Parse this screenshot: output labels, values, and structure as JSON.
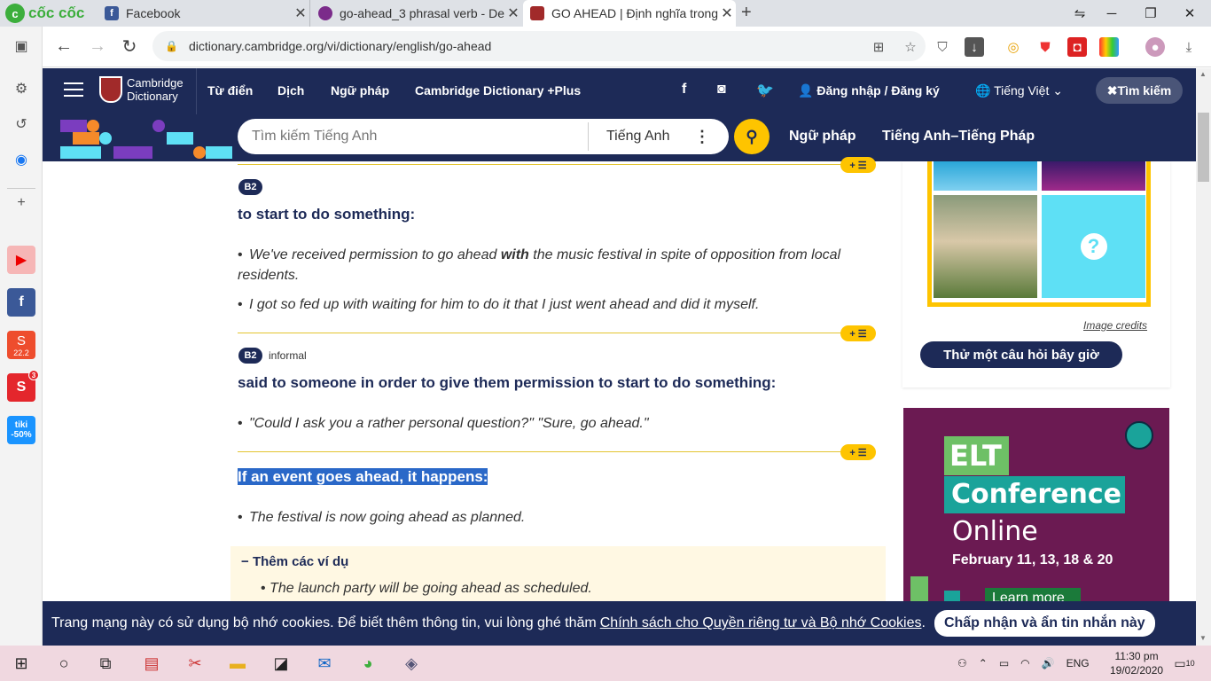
{
  "browser": {
    "brand": "cốc cốc",
    "tabs": [
      {
        "title": "Facebook"
      },
      {
        "title": "go-ahead_3 phrasal verb - De"
      },
      {
        "title": "GO AHEAD | Định nghĩa trong"
      }
    ],
    "url": "dictionary.cambridge.org/vi/dictionary/english/go-ahead"
  },
  "sidebar": {
    "shopee_badge": "22.2",
    "sendo_badge": "3",
    "tiki_label": "tiki",
    "tiki_discount": "-50%"
  },
  "header": {
    "logo_line1": "Cambridge",
    "logo_line2": "Dictionary",
    "nav": [
      "Từ điển",
      "Dịch",
      "Ngữ pháp",
      "Cambridge Dictionary +Plus"
    ],
    "login": "Đăng nhập / Đăng ký",
    "language": "Tiếng Việt",
    "search_toggle": "Tìm kiếm"
  },
  "search": {
    "placeholder": "Tìm kiếm Tiếng Anh",
    "dictionary": "Tiếng Anh",
    "links": [
      "Ngữ pháp",
      "Tiếng Anh–Tiếng Pháp"
    ]
  },
  "entry": {
    "senses": [
      {
        "level": "B2",
        "label": "",
        "definition": "to start to do something:",
        "examples": [
          {
            "pre": "We've received permission to go ahead ",
            "bold": "with",
            "post": " the music festival in spite of opposition from local residents."
          },
          {
            "pre": "I got so fed up with waiting for him to do it that I just went ahead and did it myself.",
            "bold": "",
            "post": ""
          }
        ]
      },
      {
        "level": "B2",
        "label": "informal",
        "definition": "said to someone in order to give them permission to start to do something:",
        "examples": [
          {
            "pre": "\"Could I ask you a rather personal question?\" \"Sure, go ahead.\"",
            "bold": "",
            "post": ""
          }
        ]
      },
      {
        "level": "",
        "label": "",
        "definition": "If an event goes ahead, it happens:",
        "examples": [
          {
            "pre": "The festival is now going ahead as planned.",
            "bold": "",
            "post": ""
          }
        ]
      }
    ],
    "add_button": "+ ☰",
    "more_examples": {
      "title": "Thêm các ví dụ",
      "items": [
        "The launch party will be going ahead as scheduled."
      ]
    }
  },
  "quiz": {
    "credits": "Image credits",
    "button": "Thử một câu hỏi bây giờ"
  },
  "ad": {
    "line1": "ELT",
    "line2": "Conference",
    "line3": "Online",
    "dates": "February 11, 13, 18 & 20",
    "cta": "Learn more"
  },
  "cookie": {
    "text": "Trang mạng này có sử dụng bộ nhớ cookies. Để biết thêm thông tin, vui lòng ghé thăm",
    "link": "Chính sách cho Quyền riêng tư và Bộ nhớ Cookies",
    "period": ".",
    "accept": "Chấp nhận và ẩn tin nhắn này"
  },
  "taskbar": {
    "lang": "ENG",
    "time": "11:30 pm",
    "date": "19/02/2020",
    "notif": "10"
  }
}
